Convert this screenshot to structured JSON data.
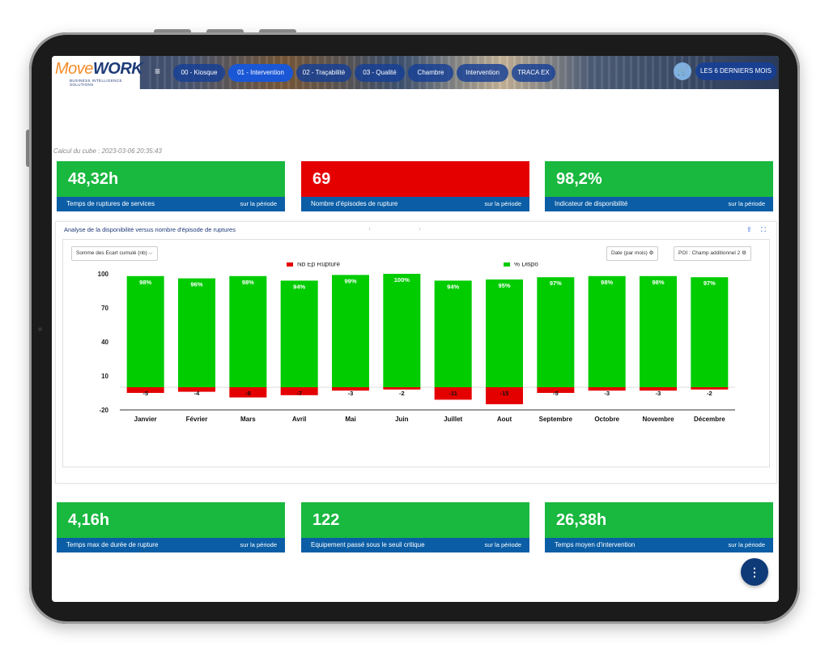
{
  "app": {
    "logo_move": "Move",
    "logo_work": "WORK",
    "logo_tagline": "BUSINESS INTELLIGENCE SOLUTIONS"
  },
  "nav": {
    "menu_icon": "hamburger-icon",
    "tabs": [
      {
        "label": "00 - Kiosque",
        "active": false
      },
      {
        "label": "01 - Intervention",
        "active": true
      },
      {
        "label": "02 - Traçabilité",
        "active": false
      },
      {
        "label": "03 - Qualité",
        "active": false
      },
      {
        "label": "Chambre",
        "active": false
      },
      {
        "label": "Intervention",
        "active": false
      },
      {
        "label": "TRACA EX",
        "active": false
      }
    ],
    "cart_icon": "cart-icon",
    "period_button": "LES 6 DERNIERS MOIS"
  },
  "calc_text": "Calcul du cube : 2023-03-06 20:35:43",
  "kpis_top": [
    {
      "value": "48,32h",
      "label": "Temps de ruptures de services",
      "period": "sur la période",
      "color": "#19b83f"
    },
    {
      "value": "69",
      "label": "Nombre d'épisodes de rupture",
      "period": "sur la période",
      "color": "#e50000"
    },
    {
      "value": "98,2%",
      "label": "Indicateur de disponibilité",
      "period": "sur la période",
      "color": "#19b83f"
    }
  ],
  "panel": {
    "title": "Analyse de la disponibilité versus nombre d'épisode de ruptures",
    "measure_select": "Somme des Ecart cumulé (nb)",
    "date_select": "Date (par mois)",
    "poi_select": "POI : Champ additionnel 2",
    "export_icon": "export-icon",
    "fullscreen_icon": "fullscreen-icon",
    "gear_icon": "gear-icon"
  },
  "chart_data": {
    "type": "bar",
    "categories": [
      "Janvier",
      "Février",
      "Mars",
      "Avril",
      "Mai",
      "Juin",
      "Juillet",
      "Aout",
      "Septembre",
      "Octobre",
      "Novembre",
      "Décembre"
    ],
    "series": [
      {
        "name": "Nb Ep Rupture",
        "color": "#e50000",
        "values": [
          -5,
          -4,
          -9,
          -7,
          -3,
          -2,
          -11,
          -15,
          -5,
          -3,
          -3,
          -2
        ]
      },
      {
        "name": "% Dispo",
        "color": "#00cc00",
        "values": [
          98,
          96,
          98,
          94,
          99,
          100,
          94,
          95,
          97,
          98,
          98,
          97
        ]
      }
    ],
    "labels_neg": [
      "-5",
      "-4",
      "-9",
      "-7",
      "-3",
      "-2",
      "-11",
      "-15",
      "-5",
      "-3",
      "-3",
      "-2"
    ],
    "labels_pos": [
      "98%",
      "96%",
      "98%",
      "94%",
      "99%",
      "100%",
      "94%",
      "95%",
      "97%",
      "98%",
      "98%",
      "97%"
    ],
    "yticks": [
      100,
      70,
      40,
      10,
      -20
    ],
    "ylim": [
      -20,
      100
    ],
    "legend_position": "top"
  },
  "kpis_bottom": [
    {
      "value": "4,16h",
      "label": "Temps max de durée de rupture",
      "period": "sur la période",
      "color": "#19b83f"
    },
    {
      "value": "122",
      "label": "Equipement passé sous le seuil critique",
      "period": "sur la période",
      "color": "#19b83f"
    },
    {
      "value": "26,38h",
      "label": "Temps moyen d'intervention",
      "period": "sur la période",
      "color": "#19b83f"
    }
  ],
  "fab_icon": "more-vertical-icon"
}
